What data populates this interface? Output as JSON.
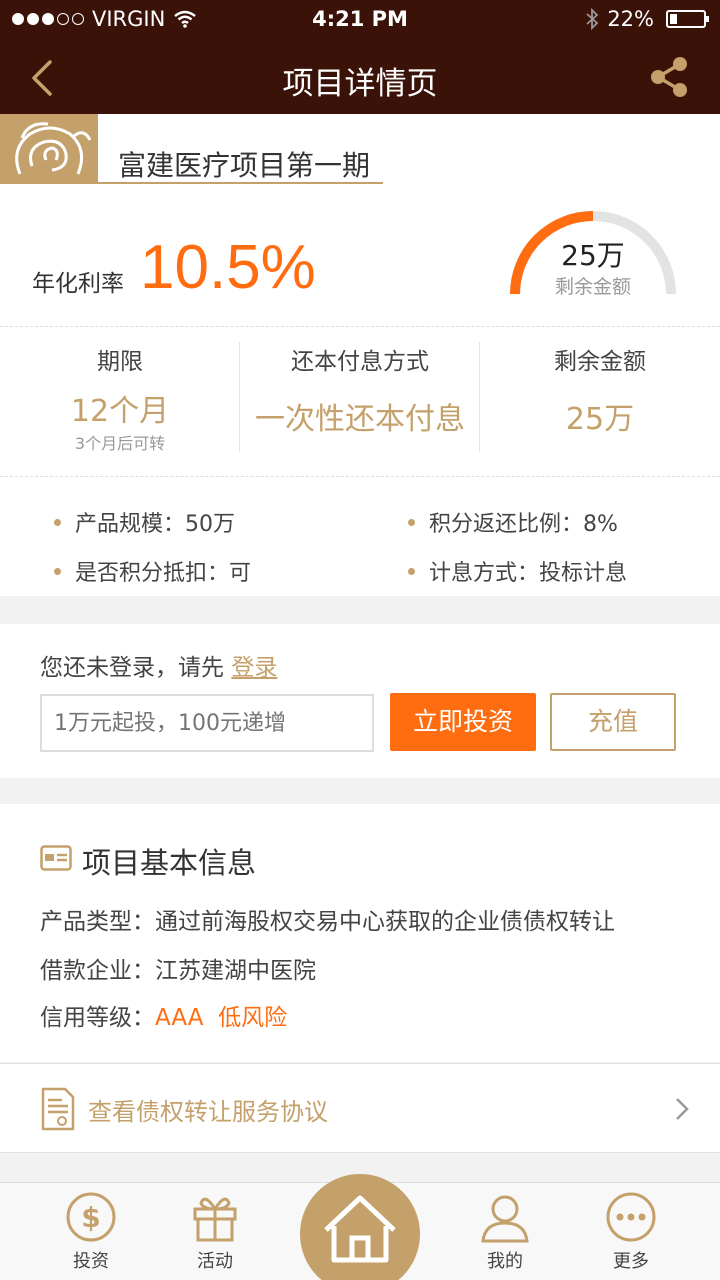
{
  "status_bar": {
    "carrier": "VIRGIN",
    "time": "4:21 PM",
    "battery": "22%",
    "battery_level": 0.22
  },
  "nav": {
    "title": "项目详情页",
    "back_icon": "chevron-left-icon",
    "share_icon": "share-icon"
  },
  "project": {
    "name": "富建医疗项目第一期",
    "rate_label": "年化利率",
    "rate_value": "10.5%",
    "gauge_value": "25万",
    "gauge_label": "剩余金额",
    "gauge_fraction": 0.5
  },
  "stats": [
    {
      "label": "期限",
      "value": "12个月",
      "sub": "3个月后可转"
    },
    {
      "label": "还本付息方式",
      "value": "一次性还本付息",
      "sub": ""
    },
    {
      "label": "剩余金额",
      "value": "25万",
      "sub": ""
    }
  ],
  "facts": [
    "产品规模：50万",
    "积分返还比例：8%",
    "是否积分抵扣：可",
    "计息方式：投标计息"
  ],
  "invest": {
    "login_prompt": "您还未登录，请先",
    "login_link": "登录",
    "amount_placeholder": "1万元起投，100元递增",
    "invest_button": "立即投资",
    "recharge_button": "充值"
  },
  "basic_info": {
    "title": "项目基本信息",
    "rows": [
      {
        "label": "产品类型：",
        "value": "通过前海股权交易中心获取的企业债债权转让"
      },
      {
        "label": "借款企业：",
        "value": "江苏建湖中医院"
      },
      {
        "label": "信用等级：",
        "value": "AAA  低风险"
      }
    ]
  },
  "agreement": {
    "label": "查看债权转让服务协议"
  },
  "tabbar": {
    "tabs": [
      {
        "label": "投资",
        "icon": "dollar-icon"
      },
      {
        "label": "活动",
        "icon": "gift-icon"
      },
      {
        "label": "",
        "icon": "home-icon"
      },
      {
        "label": "我的",
        "icon": "user-icon"
      },
      {
        "label": "更多",
        "icon": "more-icon"
      }
    ]
  },
  "colors": {
    "header_bg": "#3b1208",
    "gold": "#c4a06b",
    "orange": "#ff6d10"
  }
}
